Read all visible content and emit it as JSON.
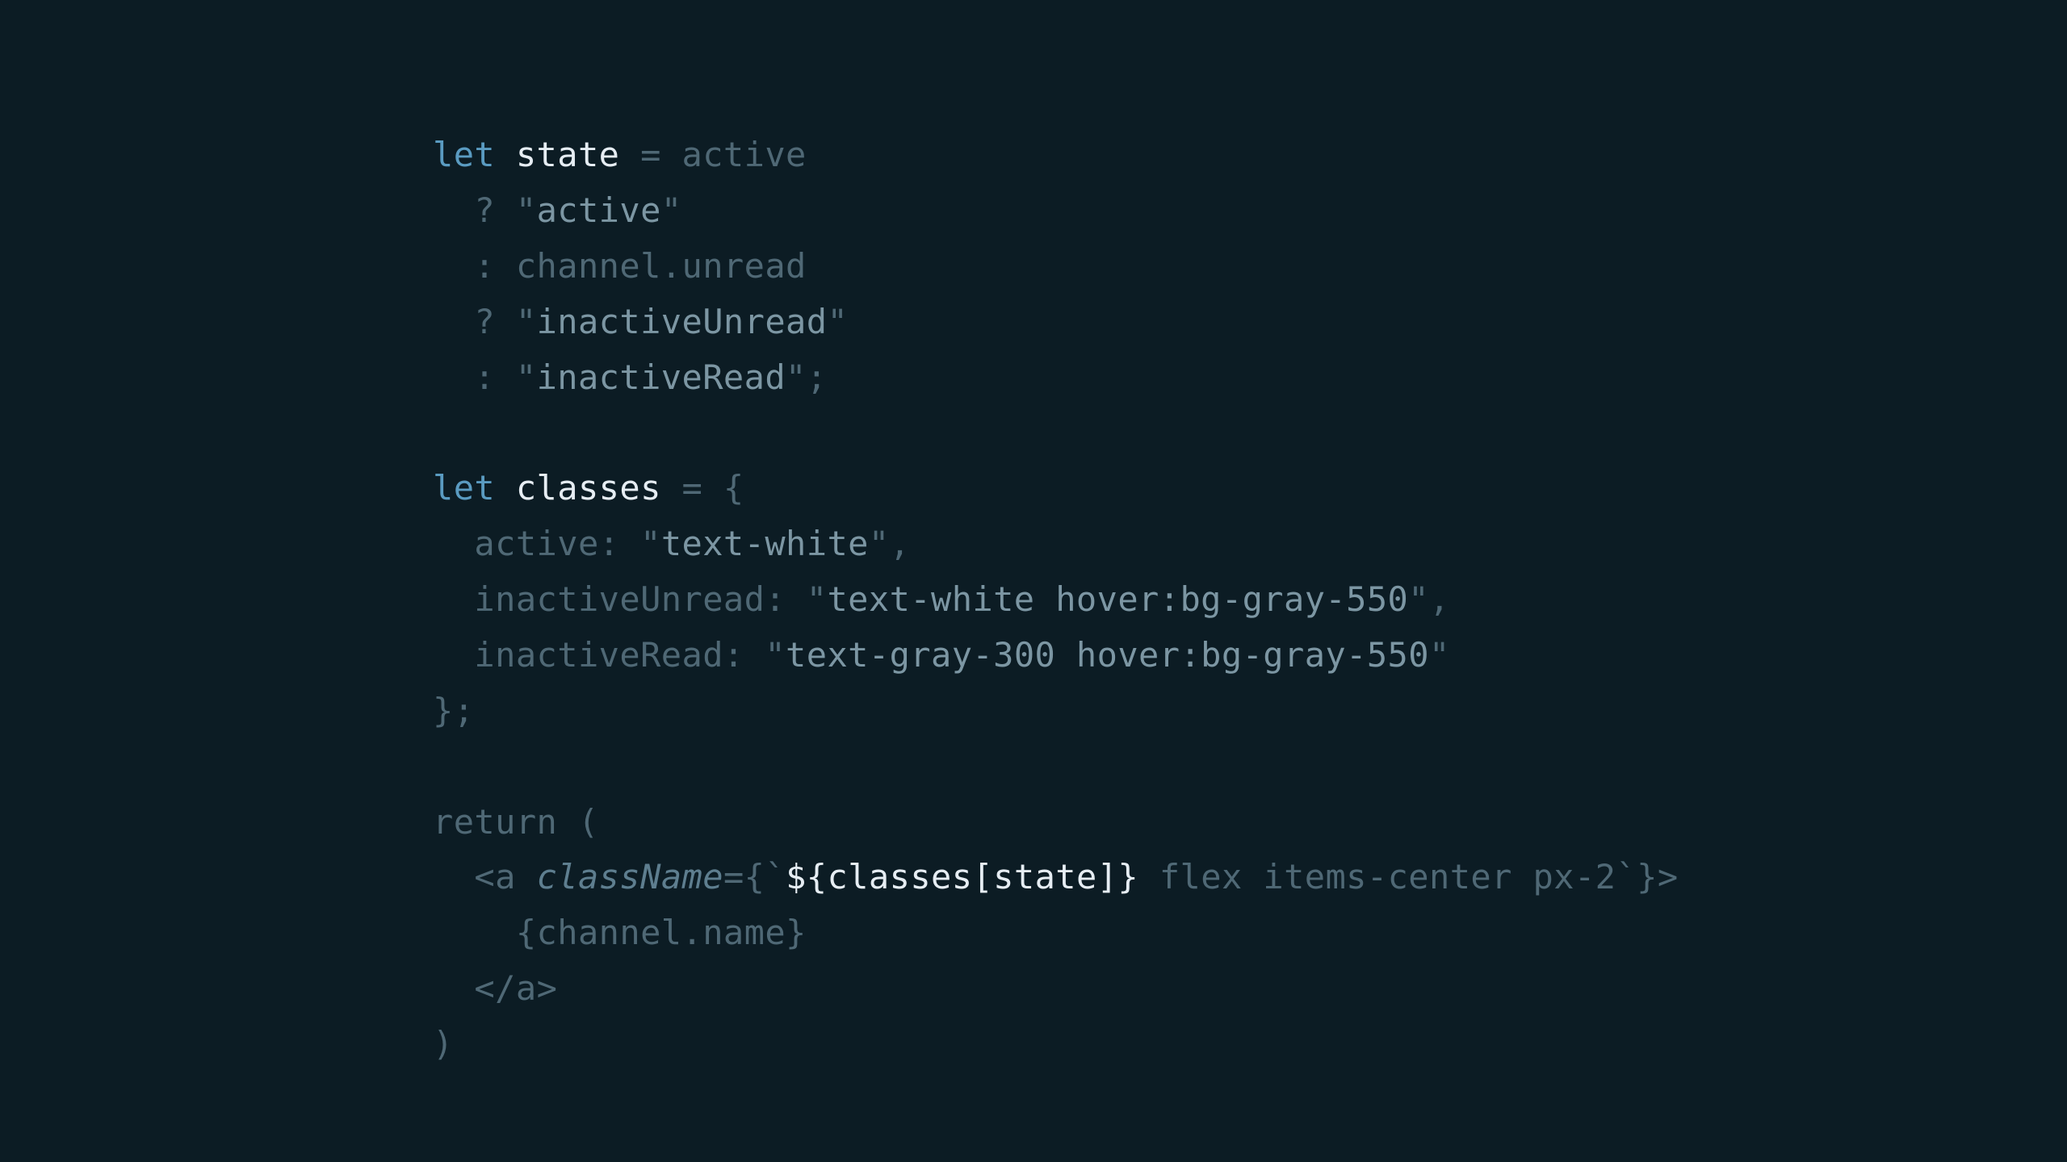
{
  "code": {
    "l1": {
      "let": "let",
      "sp": " ",
      "state": "state",
      "eq": " = ",
      "active": "active"
    },
    "l2": {
      "indent": "  ",
      "q": "? ",
      "open": "\"",
      "val": "active",
      "close": "\""
    },
    "l3": {
      "indent": "  ",
      "c": ": ",
      "expr": "channel.unread"
    },
    "l4": {
      "indent": "  ",
      "q": "? ",
      "open": "\"",
      "val": "inactiveUnread",
      "close": "\""
    },
    "l5": {
      "indent": "  ",
      "c": ": ",
      "open": "\"",
      "val": "inactiveRead",
      "close": "\"",
      "semi": ";"
    },
    "l6": {
      "blank": ""
    },
    "l7": {
      "let": "let",
      "sp": " ",
      "classes": "classes",
      "eq": " = {"
    },
    "l8": {
      "indent": "  ",
      "key": "active",
      "colon": ": ",
      "open": "\"",
      "val": "text-white",
      "close": "\"",
      "comma": ","
    },
    "l9": {
      "indent": "  ",
      "key": "inactiveUnread",
      "colon": ": ",
      "open": "\"",
      "val": "text-white hover:bg-gray-550",
      "close": "\"",
      "comma": ","
    },
    "l10": {
      "indent": "  ",
      "key": "inactiveRead",
      "colon": ": ",
      "open": "\"",
      "val": "text-gray-300 hover:bg-gray-550",
      "close": "\""
    },
    "l11": {
      "close": "};"
    },
    "l12": {
      "blank": ""
    },
    "l13": {
      "return": "return",
      "paren": " ("
    },
    "l14": {
      "indent": "  ",
      "open_tag": "<",
      "a": "a",
      "sp": " ",
      "className": "className",
      "eq": "=",
      "brace_open": "{",
      "tick_open": "`",
      "dollar": "${",
      "expr": "classes[state]",
      "close_dollar": "}",
      "rest": " flex items-center px-2",
      "tick_close": "`",
      "brace_close": "}",
      "gt": ">"
    },
    "l15": {
      "indent": "    ",
      "open": "{",
      "expr": "channel.name",
      "close": "}"
    },
    "l16": {
      "indent": "  ",
      "open": "</",
      "a": "a",
      "gt": ">"
    },
    "l17": {
      "paren": ")"
    }
  }
}
